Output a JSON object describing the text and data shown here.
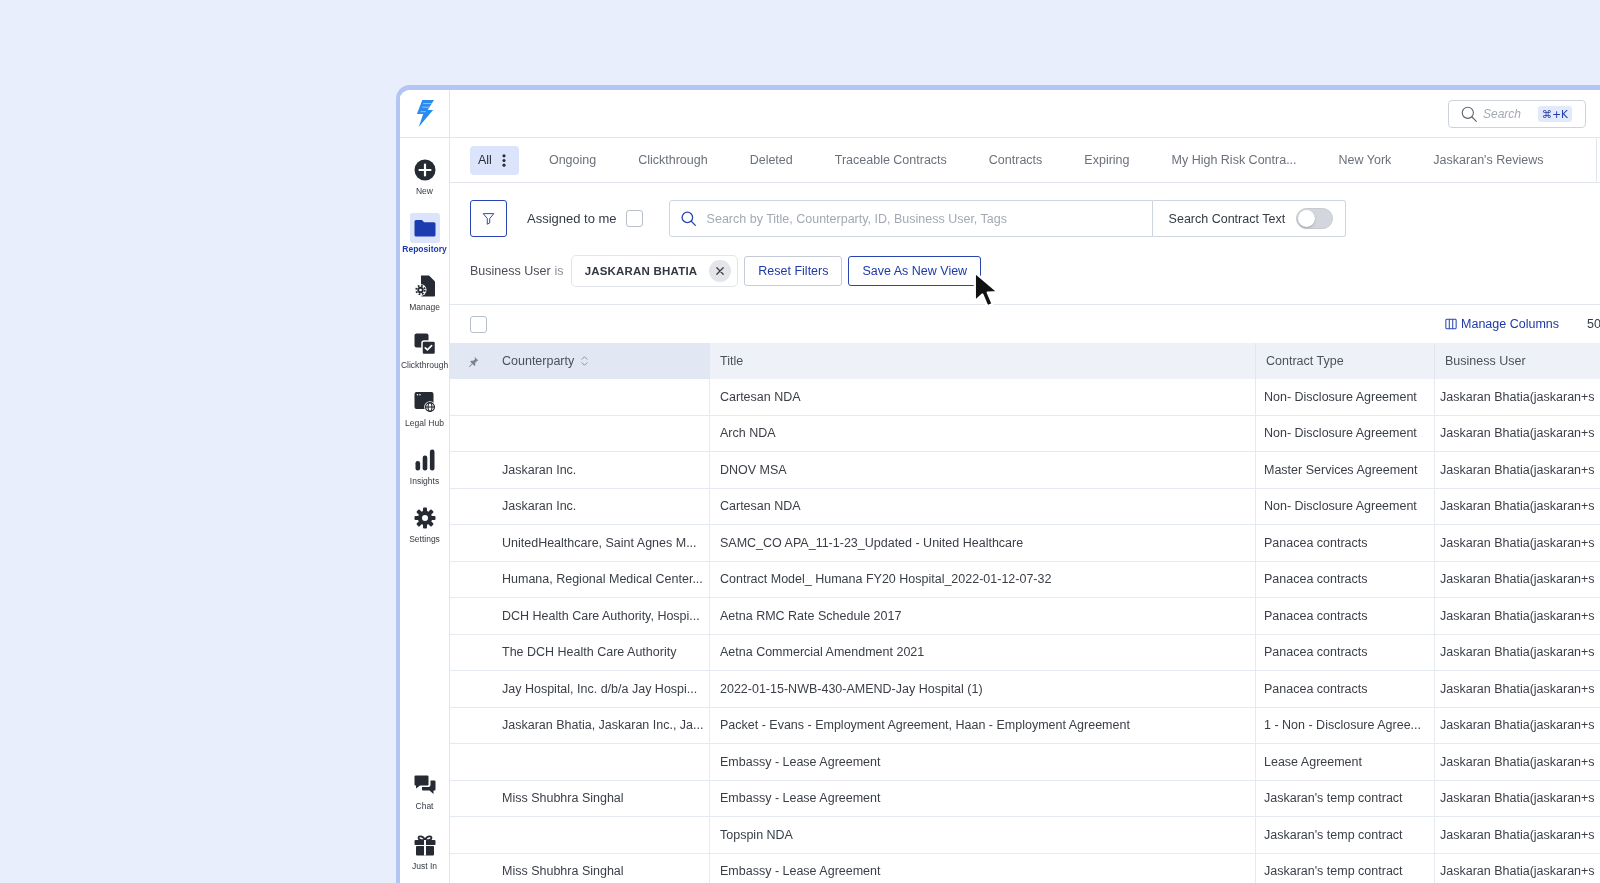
{
  "sidebar": {
    "items": [
      {
        "label": "New",
        "selected": false
      },
      {
        "label": "Repository",
        "selected": true
      },
      {
        "label": "Manage",
        "selected": false
      },
      {
        "label": "Clickthrough",
        "selected": false
      },
      {
        "label": "Legal Hub",
        "selected": false
      },
      {
        "label": "Insights",
        "selected": false
      },
      {
        "label": "Settings",
        "selected": false
      }
    ],
    "bottom_items": [
      {
        "label": "Chat",
        "selected": false
      },
      {
        "label": "Just In",
        "selected": false
      }
    ]
  },
  "top_bar": {
    "search": {
      "placeholder": "Search",
      "shortcut": "⌘+K"
    }
  },
  "tabs": [
    {
      "label": "All",
      "selected": true
    },
    {
      "label": "Ongoing",
      "selected": false
    },
    {
      "label": "Clickthrough",
      "selected": false
    },
    {
      "label": "Deleted",
      "selected": false
    },
    {
      "label": "Traceable Contracts",
      "selected": false
    },
    {
      "label": "Contracts",
      "selected": false
    },
    {
      "label": "Expiring",
      "selected": false
    },
    {
      "label": "My High Risk Contra...",
      "selected": false
    },
    {
      "label": "New York",
      "selected": false
    },
    {
      "label": "Jaskaran's Reviews",
      "selected": false
    }
  ],
  "filters": {
    "assigned_to_me": {
      "label": "Assigned to me",
      "checked": false
    },
    "search": {
      "placeholder": "Search by Title, Counterparty, ID, Business User, Tags"
    },
    "search_contract_text": {
      "label": "Search Contract Text",
      "on": false
    },
    "active_filter": {
      "field": "Business User",
      "operator": "is",
      "value": "JASKARAN BHATIA"
    },
    "buttons": [
      {
        "label": "Reset Filters",
        "hovered": false
      },
      {
        "label": "Save As New View",
        "hovered": true
      }
    ]
  },
  "table": {
    "select_all": {
      "checked": false
    },
    "manage_columns": "Manage Columns",
    "page_size": "50",
    "columns": [
      {
        "label": "Counterparty",
        "pinned": true,
        "sortable": true
      },
      {
        "label": "Title",
        "pinned": false,
        "sortable": false
      },
      {
        "label": "Contract Type",
        "pinned": false,
        "sortable": false
      },
      {
        "label": "Business User",
        "pinned": false,
        "sortable": false
      }
    ],
    "rows": [
      {
        "title": "Cartesan NDA",
        "contract_type": "Non- Disclosure Agreement",
        "business_user": "Jaskaran Bhatia(jaskaran+s"
      },
      {
        "title": "Arch NDA",
        "contract_type": "Non- Disclosure Agreement",
        "business_user": "Jaskaran Bhatia(jaskaran+s"
      },
      {
        "counterparty": "Jaskaran Inc.",
        "title": "DNOV MSA",
        "contract_type": "Master Services Agreement",
        "business_user": "Jaskaran Bhatia(jaskaran+s"
      },
      {
        "counterparty": "Jaskaran Inc.",
        "title": "Cartesan NDA",
        "contract_type": "Non- Disclosure Agreement",
        "business_user": "Jaskaran Bhatia(jaskaran+s"
      },
      {
        "counterparty": "UnitedHealthcare, Saint Agnes M...",
        "title": "SAMC_CO APA_11-1-23_Updated - United Healthcare",
        "contract_type": "Panacea contracts",
        "business_user": "Jaskaran Bhatia(jaskaran+s"
      },
      {
        "counterparty": "Humana, Regional Medical Center...",
        "title": "Contract Model_ Humana FY20 Hospital_2022-01-12-07-32",
        "contract_type": "Panacea contracts",
        "business_user": "Jaskaran Bhatia(jaskaran+s"
      },
      {
        "counterparty": "DCH Health Care Authority, Hospi...",
        "title": "Aetna RMC Rate Schedule 2017",
        "contract_type": "Panacea contracts",
        "business_user": "Jaskaran Bhatia(jaskaran+s"
      },
      {
        "counterparty": "The DCH Health Care Authority",
        "title": "Aetna Commercial Amendment 2021",
        "contract_type": "Panacea contracts",
        "business_user": "Jaskaran Bhatia(jaskaran+s"
      },
      {
        "counterparty": "Jay Hospital, Inc. d/b/a Jay Hospi...",
        "title": "2022-01-15-NWB-430-AMEND-Jay Hospital (1)",
        "contract_type": "Panacea contracts",
        "business_user": "Jaskaran Bhatia(jaskaran+s"
      },
      {
        "counterparty": "Jaskaran Bhatia, Jaskaran Inc., Ja...",
        "title": "Packet - Evans - Employment Agreement, Haan - Employment Agreement",
        "contract_type": "1 - Non - Disclosure Agree...",
        "business_user": "Jaskaran Bhatia(jaskaran+s"
      },
      {
        "title": "Embassy - Lease Agreement",
        "contract_type": "Lease Agreement",
        "business_user": "Jaskaran Bhatia(jaskaran+s"
      },
      {
        "counterparty": "Miss Shubhra Singhal",
        "title": "Embassy - Lease Agreement",
        "contract_type": "Jaskaran's temp contract",
        "business_user": "Jaskaran Bhatia(jaskaran+s"
      },
      {
        "title": "Topspin NDA",
        "contract_type": "Jaskaran's temp contract",
        "business_user": "Jaskaran Bhatia(jaskaran+s"
      },
      {
        "counterparty": "Miss Shubhra Singhal",
        "title": "Embassy - Lease Agreement",
        "contract_type": "Jaskaran's temp contract",
        "business_user": "Jaskaran Bhatia(jaskaran+s"
      }
    ]
  }
}
